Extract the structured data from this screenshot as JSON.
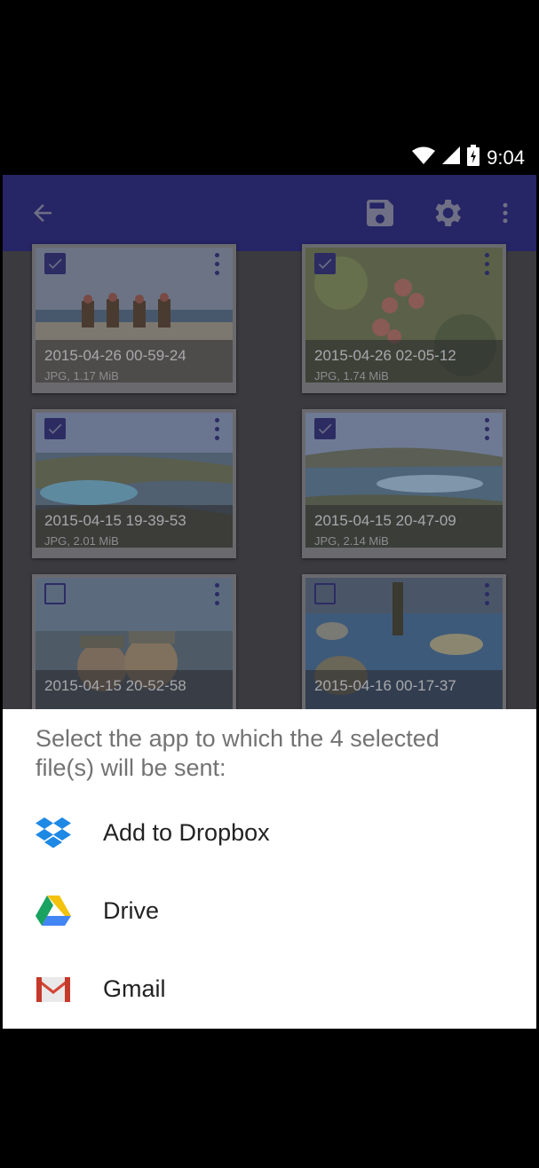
{
  "status_bar": {
    "time": "9:04"
  },
  "toolbar": {
    "back_icon": "arrow-back-icon",
    "save_icon": "save-icon",
    "settings_icon": "gear-icon",
    "more_icon": "more-vert-icon",
    "background_color": "#262565"
  },
  "photos": [
    {
      "date": "2015-04-26 00-59-24",
      "info": "JPG, 1.17 MiB",
      "selected": true
    },
    {
      "date": "2015-04-26 02-05-12",
      "info": "JPG, 1.74 MiB",
      "selected": true
    },
    {
      "date": "2015-04-15 19-39-53",
      "info": "JPG, 2.01 MiB",
      "selected": true
    },
    {
      "date": "2015-04-15 20-47-09",
      "info": "JPG, 2.14 MiB",
      "selected": true
    },
    {
      "date": "2015-04-15 20-52-58",
      "info": "",
      "selected": false
    },
    {
      "date": "2015-04-16 00-17-37",
      "info": "",
      "selected": false
    }
  ],
  "share_sheet": {
    "title": "Select the app to which the 4 selected file(s) will be sent:",
    "apps": [
      {
        "label": "Add to Dropbox",
        "icon": "dropbox-icon"
      },
      {
        "label": "Drive",
        "icon": "google-drive-icon"
      },
      {
        "label": "Gmail",
        "icon": "gmail-icon"
      }
    ]
  }
}
